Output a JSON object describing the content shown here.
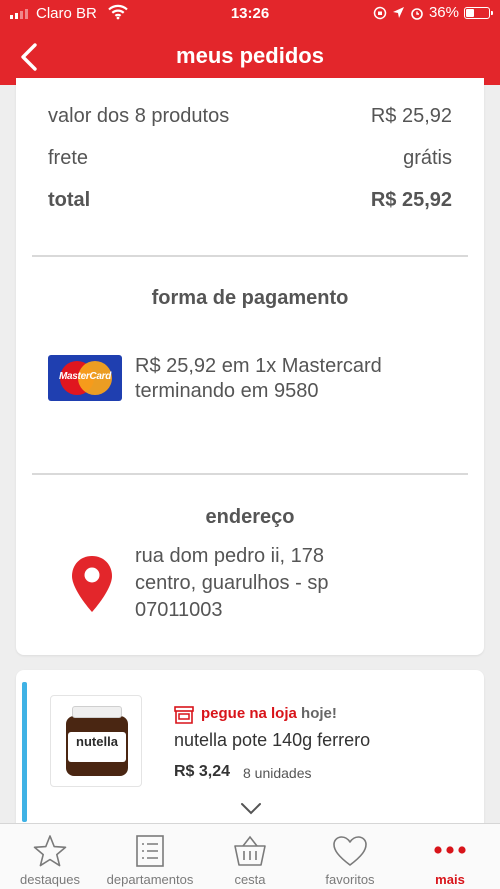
{
  "status_bar": {
    "carrier": "Claro BR",
    "time": "13:26",
    "battery": "36%",
    "battery_level": 0.36
  },
  "header": {
    "title": "meus pedidos",
    "back_icon": "chevron-left-icon"
  },
  "summary": {
    "rows": [
      {
        "label": "valor dos 8 produtos",
        "value": "R$ 25,92"
      },
      {
        "label": "frete",
        "value": "grátis"
      },
      {
        "label": "total",
        "value": "R$ 25,92"
      }
    ]
  },
  "payment": {
    "title": "forma de pagamento",
    "logo_text": "MasterCard",
    "line1": "R$ 25,92 em 1x Mastercard",
    "line2": "terminando em 9580"
  },
  "address": {
    "title": "endereço",
    "line1": "rua dom pedro ii, 178",
    "line2": "centro, guarulhos - sp",
    "line3": "07011003"
  },
  "item": {
    "pickup_label": "pegue na loja",
    "pickup_when": "hoje!",
    "name": "nutella pote 140g ferrero",
    "price": "R$ 3,24",
    "units": "8 unidades",
    "thumb_brand": "nutella"
  },
  "tabs": [
    {
      "label": "destaques",
      "icon": "star-icon"
    },
    {
      "label": "departamentos",
      "icon": "list-icon"
    },
    {
      "label": "cesta",
      "icon": "basket-icon"
    },
    {
      "label": "favoritos",
      "icon": "heart-icon"
    },
    {
      "label": "mais",
      "icon": "more-icon",
      "active": true
    }
  ],
  "colors": {
    "brand_red": "#e3262b",
    "accent_blue": "#3fb2e5"
  }
}
